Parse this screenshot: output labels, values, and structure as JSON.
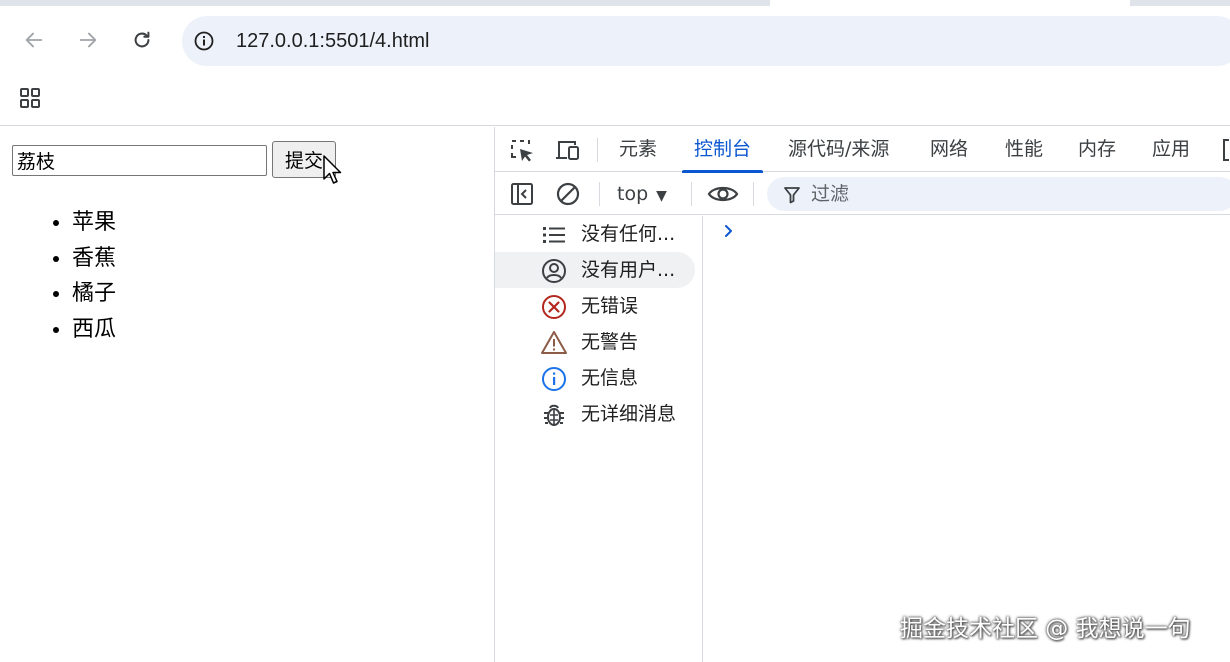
{
  "browser": {
    "url": "127.0.0.1:5501/4.html"
  },
  "page": {
    "input_value": "荔枝",
    "submit_label": "提交",
    "list_items": [
      "苹果",
      "香蕉",
      "橘子",
      "西瓜"
    ]
  },
  "devtools": {
    "tabs": [
      {
        "label": "元素"
      },
      {
        "label": "控制台"
      },
      {
        "label": "源代码/来源"
      },
      {
        "label": "网络"
      },
      {
        "label": "性能"
      },
      {
        "label": "内存"
      },
      {
        "label": "应用"
      }
    ],
    "active_tab": "控制台",
    "context": "top",
    "filter_placeholder": "过滤",
    "sidebar": [
      {
        "label": "没有任何...",
        "icon": "list-icon"
      },
      {
        "label": "没有用户...",
        "icon": "user-icon"
      },
      {
        "label": "无错误",
        "icon": "error-icon"
      },
      {
        "label": "无警告",
        "icon": "warning-icon"
      },
      {
        "label": "无信息",
        "icon": "info-icon"
      },
      {
        "label": "无详细消息",
        "icon": "bug-icon"
      }
    ]
  },
  "colors": {
    "accent": "#0b57d0",
    "error": "#b3261e",
    "warning": "#8c5c48",
    "info": "#1a73e8"
  },
  "watermark": "掘金技术社区 @ 我想说一句"
}
